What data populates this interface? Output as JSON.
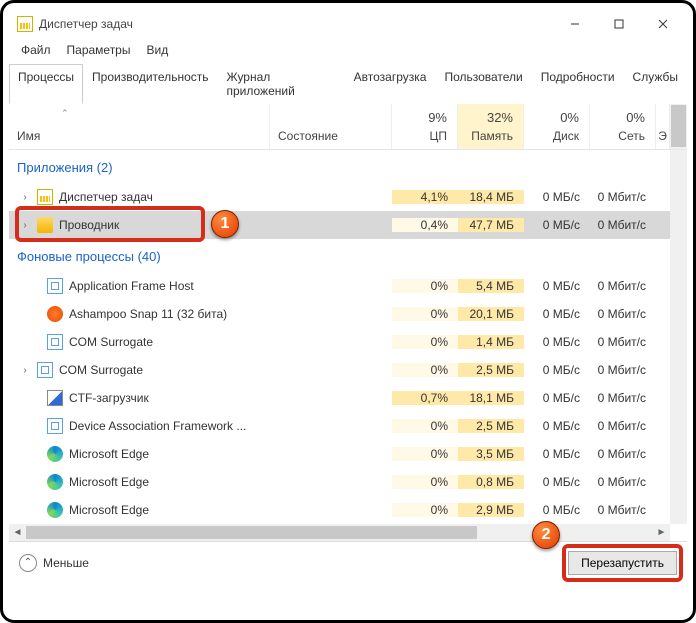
{
  "window": {
    "title": "Диспетчер задач"
  },
  "menu": {
    "file": "Файл",
    "options": "Параметры",
    "view": "Вид"
  },
  "tabs": {
    "items": [
      "Процессы",
      "Производительность",
      "Журнал приложений",
      "Автозагрузка",
      "Пользователи",
      "Подробности",
      "Службы"
    ],
    "active": 0
  },
  "columns": {
    "name": "Имя",
    "state": "Состояние",
    "cpu": {
      "pct": "9%",
      "label": "ЦП"
    },
    "mem": {
      "pct": "32%",
      "label": "Память"
    },
    "disk": {
      "pct": "0%",
      "label": "Диск"
    },
    "net": {
      "pct": "0%",
      "label": "Сеть"
    },
    "extra": "Э"
  },
  "groups": {
    "apps": "Приложения (2)",
    "bg": "Фоновые процессы (40)"
  },
  "rows": {
    "app1": {
      "name": "Диспетчер задач",
      "cpu": "4,1%",
      "mem": "18,4 МБ",
      "disk": "0 МБ/с",
      "net": "0 Мбит/с"
    },
    "app2": {
      "name": "Проводник",
      "cpu": "0,4%",
      "mem": "47,7 МБ",
      "disk": "0 МБ/с",
      "net": "0 Мбит/с"
    },
    "b1": {
      "name": "Application Frame Host",
      "cpu": "0%",
      "mem": "5,4 МБ",
      "disk": "0 МБ/с",
      "net": "0 Мбит/с"
    },
    "b2": {
      "name": "Ashampoo Snap 11 (32 бита)",
      "cpu": "0%",
      "mem": "20,1 МБ",
      "disk": "0 МБ/с",
      "net": "0 Мбит/с"
    },
    "b3": {
      "name": "COM Surrogate",
      "cpu": "0%",
      "mem": "1,4 МБ",
      "disk": "0 МБ/с",
      "net": "0 Мбит/с"
    },
    "b4": {
      "name": "COM Surrogate",
      "cpu": "0%",
      "mem": "2,5 МБ",
      "disk": "0 МБ/с",
      "net": "0 Мбит/с"
    },
    "b5": {
      "name": "CTF-загрузчик",
      "cpu": "0,7%",
      "mem": "18,1 МБ",
      "disk": "0 МБ/с",
      "net": "0 Мбит/с"
    },
    "b6": {
      "name": "Device Association Framework ...",
      "cpu": "0%",
      "mem": "2,5 МБ",
      "disk": "0 МБ/с",
      "net": "0 Мбит/с"
    },
    "b7": {
      "name": "Microsoft Edge",
      "cpu": "0%",
      "mem": "3,5 МБ",
      "disk": "0 МБ/с",
      "net": "0 Мбит/с"
    },
    "b8": {
      "name": "Microsoft Edge",
      "cpu": "0%",
      "mem": "0,8 МБ",
      "disk": "0 МБ/с",
      "net": "0 Мбит/с"
    },
    "b9": {
      "name": "Microsoft Edge",
      "cpu": "0%",
      "mem": "2,9 МБ",
      "disk": "0 МБ/с",
      "net": "0 Мбит/с"
    }
  },
  "footer": {
    "fewer": "Меньше",
    "restart": "Перезапустить"
  },
  "markers": {
    "m1": "1",
    "m2": "2"
  }
}
